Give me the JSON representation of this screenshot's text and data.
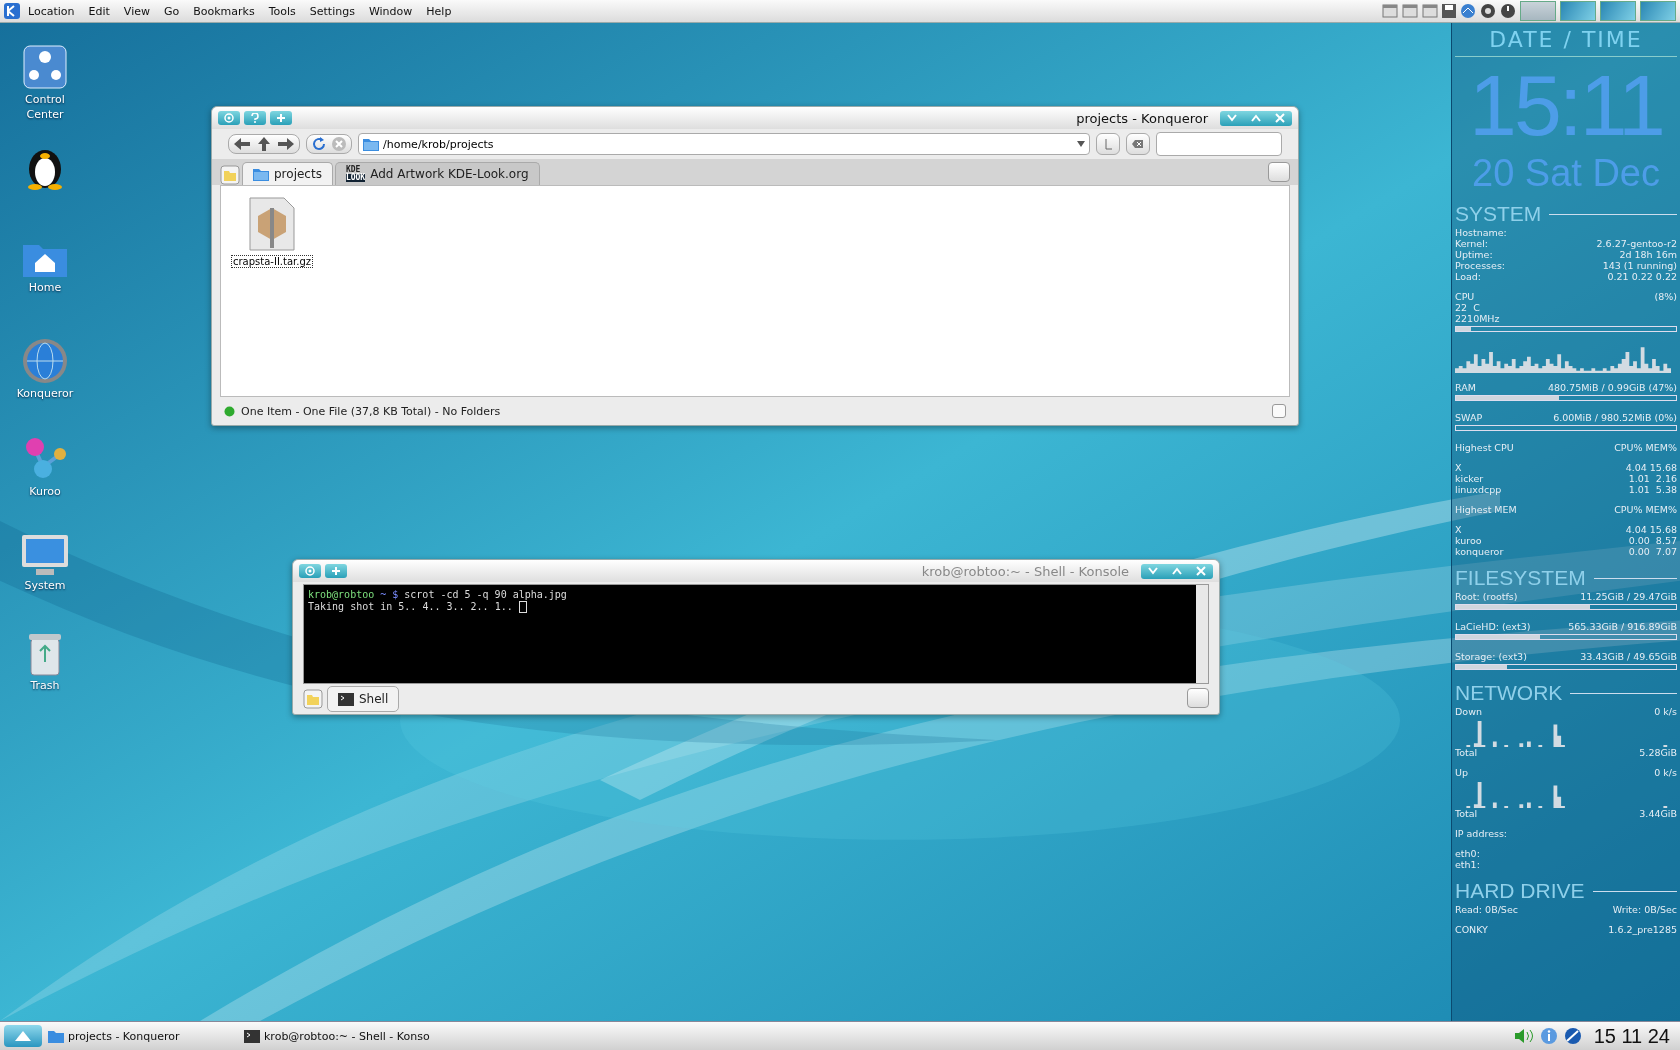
{
  "menu_bar": {
    "items": [
      "Location",
      "Edit",
      "View",
      "Go",
      "Bookmarks",
      "Tools",
      "Settings",
      "Window",
      "Help"
    ]
  },
  "desktop_icons": [
    {
      "kind": "control-center",
      "label": "Control Center"
    },
    {
      "kind": "penguin"
    },
    {
      "kind": "home",
      "label": "Home"
    },
    {
      "kind": "konqueror",
      "label": "Konqueror"
    },
    {
      "kind": "kuroo",
      "label": "Kuroo"
    },
    {
      "kind": "system",
      "label": "System"
    },
    {
      "kind": "trash",
      "label": "Trash"
    }
  ],
  "konqueror": {
    "title": "projects - Konqueror",
    "active": true,
    "location": "/home/krob/projects",
    "tabs": [
      {
        "label": "projects",
        "kind": "folder",
        "selected": true
      },
      {
        "label": "Add Artwork KDE-Look.org",
        "kind": "site",
        "icon_text": [
          "KDE",
          "LOOK"
        ],
        "selected": false
      }
    ],
    "files": [
      {
        "name": "crapsta-II.tar.gz",
        "selected": true
      }
    ],
    "status": "One Item - One File (37,8 KB Total) - No Folders"
  },
  "konsole": {
    "title": "krob@robtoo:~ - Shell - Konsole",
    "active": false,
    "lines": [
      {
        "kind": "prompt",
        "user": "krob@robtoo",
        "path": "~ $",
        "command": "scrot -cd 5 -q 90 alpha.jpg"
      },
      {
        "kind": "output",
        "text": "Taking shot in 5.. 4.. 3.. 2.. 1..",
        "cursor": true
      }
    ],
    "tabs": [
      {
        "label": "Shell",
        "selected": true
      }
    ]
  },
  "conky": {
    "header": "DATE / TIME",
    "time": "15:11",
    "date": "20 Sat Dec",
    "sections": [
      {
        "title": "SYSTEM",
        "rows": [
          {
            "kind": "pair",
            "label": "Hostname:"
          },
          {
            "kind": "pair",
            "label": "Kernel:",
            "value": "2.6.27-gentoo-r2"
          },
          {
            "kind": "pair",
            "label": "Uptime:",
            "value": "2d 18h 16m"
          },
          {
            "kind": "pair",
            "label": "Processes:",
            "value": "143 (1 running)"
          },
          {
            "kind": "pair",
            "label": "Load:",
            "value": "0.21 0.22 0.22"
          },
          {
            "kind": "blank"
          },
          {
            "kind": "pair",
            "label": "CPU",
            "value": "(8%)"
          },
          {
            "kind": "pair",
            "label": "22  C"
          },
          {
            "kind": "pair",
            "label": "2210MHz"
          },
          {
            "kind": "bar",
            "level": 0.07
          },
          {
            "kind": "blank"
          },
          {
            "kind": "graph"
          },
          {
            "kind": "blank"
          },
          {
            "kind": "pair",
            "label": "RAM",
            "value": "480.75MiB / 0.99GiB (47%)"
          },
          {
            "kind": "bar",
            "level": 0.47
          },
          {
            "kind": "blank"
          },
          {
            "kind": "pair",
            "label": "SWAP",
            "value": "6.00MiB / 980.52MiB (0%)"
          },
          {
            "kind": "bar",
            "level": 0
          },
          {
            "kind": "blank"
          },
          {
            "kind": "pair",
            "label": "Highest CPU",
            "value": "CPU% MEM%"
          },
          {
            "kind": "blank"
          },
          {
            "kind": "pair",
            "label": "X",
            "value": "4.04 15.68"
          },
          {
            "kind": "pair",
            "label": "kicker",
            "value": "1.01  2.16"
          },
          {
            "kind": "pair",
            "label": "linuxdcpp",
            "value": "1.01  5.38"
          },
          {
            "kind": "blank"
          },
          {
            "kind": "pair",
            "label": "Highest MEM",
            "value": "CPU% MEM%"
          },
          {
            "kind": "blank"
          },
          {
            "kind": "pair",
            "label": "X",
            "value": "4.04 15.68"
          },
          {
            "kind": "pair",
            "label": "kuroo",
            "value": "0.00  8.57"
          },
          {
            "kind": "pair",
            "label": "konqueror",
            "value": "0.00  7.07"
          }
        ]
      },
      {
        "title": "FILESYSTEM",
        "rows": [
          {
            "kind": "pair",
            "label": "Root: (rootfs)",
            "value": "11.25GiB / 29.47GiB"
          },
          {
            "kind": "bar",
            "level": 0.61
          },
          {
            "kind": "blank"
          },
          {
            "kind": "pair",
            "label": "LaCieHD: (ext3)",
            "value": "565.33GiB / 916.89GiB"
          },
          {
            "kind": "bar",
            "level": 0.38
          },
          {
            "kind": "blank"
          },
          {
            "kind": "pair",
            "label": "Storage: (ext3)",
            "value": "33.43GiB / 49.65GiB"
          },
          {
            "kind": "bar",
            "level": 0.23
          }
        ]
      },
      {
        "title": "NETWORK",
        "rows": [
          {
            "kind": "pair",
            "label": "Down",
            "value": "0 k/s"
          },
          {
            "kind": "graph"
          },
          {
            "kind": "pair",
            "label": "Total",
            "value": "5.28GiB"
          },
          {
            "kind": "blank"
          },
          {
            "kind": "pair",
            "label": "Up",
            "value": "0 k/s"
          },
          {
            "kind": "graph"
          },
          {
            "kind": "pair",
            "label": "Total",
            "value": "3.44GiB"
          },
          {
            "kind": "blank"
          },
          {
            "kind": "pair",
            "label": "IP address:"
          },
          {
            "kind": "blank"
          },
          {
            "kind": "pair",
            "label": "eth0:"
          },
          {
            "kind": "pair",
            "label": "eth1:"
          }
        ]
      },
      {
        "title": "HARD DRIVE",
        "rows": [
          {
            "kind": "pair",
            "label": "Read: 0B/Sec",
            "value": "Write: 0B/Sec"
          },
          {
            "kind": "blank"
          },
          {
            "kind": "pair",
            "label": "CONKY",
            "value": "1.6.2_pre1285"
          }
        ]
      }
    ]
  },
  "taskbar": {
    "tasks": [
      {
        "label": "projects - Konqueror",
        "kind": "folder"
      },
      {
        "label": "krob@robtoo:~ - Shell - Konso",
        "kind": "terminal"
      }
    ],
    "clock": "15 11 24"
  }
}
